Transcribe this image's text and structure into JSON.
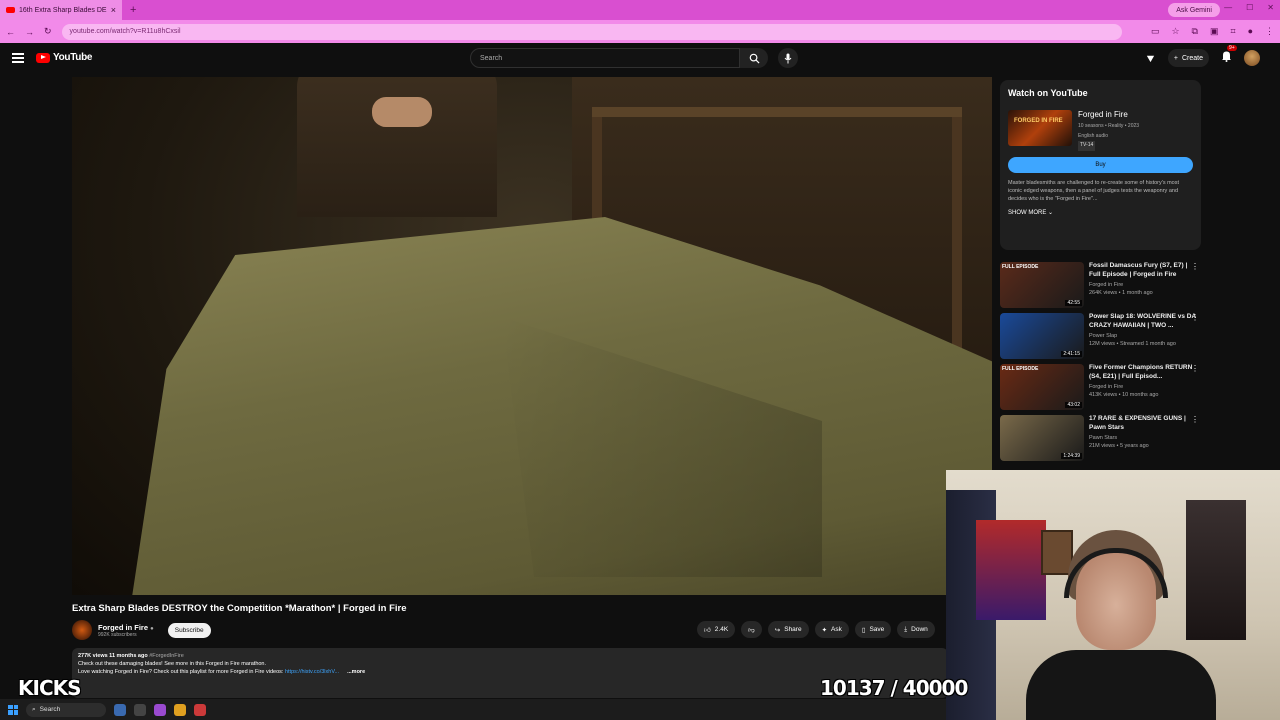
{
  "browser": {
    "tab_title": "16th Extra Sharp Blades DE",
    "url": "youtube.com/watch?v=R11u8hCxsil",
    "ask_gemini": "Ask Gemini"
  },
  "header": {
    "logo_text": "YouTube",
    "search_placeholder": "Search",
    "create_label": "Create",
    "notif_count": "9+"
  },
  "video": {
    "title": "Extra Sharp Blades DESTROY the Competition *Marathon* | Forged in Fire",
    "channel": "Forged in Fire",
    "subscribers": "992K subscribers",
    "subscribe_label": "Subscribe",
    "likes": "2.4K",
    "share_label": "Share",
    "ask_label": "Ask",
    "save_label": "Save",
    "download_label": "Down",
    "description": {
      "meta": "277K views  11 months ago",
      "hashtag": "#ForgedInFire",
      "line1": "Check out these damaging blades! See more in this Forged in Fire marathon.",
      "line2": "Love watching Forged in Fire? Check out this playlist for more Forged in Fire videos:",
      "link": "https://histv.co/3lxhV...",
      "more": "...more"
    }
  },
  "watch_card": {
    "heading": "Watch on YouTube",
    "show_title": "Forged in Fire",
    "meta_line": "10 seasons • Reality • 2023",
    "audio_line": "English audio",
    "rating": "TV-14",
    "thumb_text": "FORGED IN FIRE",
    "buy_label": "Buy",
    "description": "Master bladesmiths are challenged to re-create some of history's most iconic edged weapons, then a panel of judges tests the weaponry and decides who is the \"Forged in Fire\"...",
    "show_more": "SHOW MORE"
  },
  "recommendations": [
    {
      "title": "Fossil Damascus Fury (S7, E7) | Full Episode | Forged in Fire",
      "channel": "Forged in Fire",
      "meta": "264K views • 1 month ago",
      "duration": "42:55",
      "tag": "FULL EPISODE",
      "color": "#5a2a1a"
    },
    {
      "title": "Power Slap 18: WOLVERINE vs DA CRAZY HAWAIIAN | TWO ...",
      "channel": "Power Slap",
      "meta": "12M views • Streamed 1 month ago",
      "duration": "2:41:15",
      "tag": "",
      "color": "#1a4a9a"
    },
    {
      "title": "Five Former Champions RETURN (S4, E21) | Full Episod...",
      "channel": "Forged in Fire",
      "meta": "413K views • 10 months ago",
      "duration": "43:02",
      "tag": "FULL EPISODE",
      "color": "#6a2a14"
    },
    {
      "title": "17 RARE & EXPENSIVE GUNS | Pawn Stars",
      "channel": "Pawn Stars",
      "meta": "21M views • 5 years ago",
      "duration": "1:24:39",
      "tag": "",
      "color": "#7a6a4a"
    }
  ],
  "overlays": {
    "kicks": "KICKS",
    "counter": "10137 / 40000"
  },
  "taskbar": {
    "search": "Search"
  }
}
